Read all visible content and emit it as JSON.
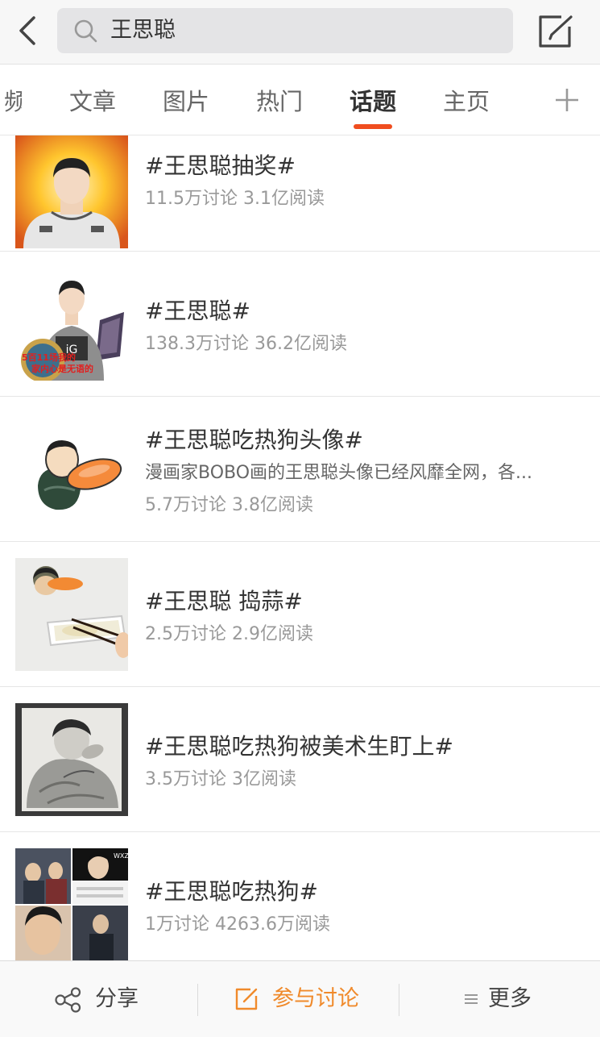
{
  "header": {
    "search_query": "王思聪"
  },
  "tabs": [
    {
      "label": "频"
    },
    {
      "label": "文章"
    },
    {
      "label": "图片"
    },
    {
      "label": "热门"
    },
    {
      "label": "话题"
    },
    {
      "label": "主页"
    }
  ],
  "active_tab": "话题",
  "topics": [
    {
      "title": "#王思聪抽奖#",
      "meta": "11.5万讨论 3.1亿阅读"
    },
    {
      "title": "#王思聪#",
      "meta": "138.3万讨论 36.2亿阅读",
      "badge_text": "5百11场我的家内心是无语的"
    },
    {
      "title": "#王思聪吃热狗头像#",
      "desc": "漫画家BOBO画的王思聪头像已经风靡全网，各...",
      "meta": "5.7万讨论 3.8亿阅读"
    },
    {
      "title": "#王思聪 捣蒜#",
      "meta": "2.5万讨论 2.9亿阅读"
    },
    {
      "title": "#王思聪吃热狗被美术生盯上#",
      "meta": "3.5万讨论 3亿阅读"
    },
    {
      "title": "#王思聪吃热狗#",
      "meta": "1万讨论 4263.6万阅读",
      "collage_text": "WXZ"
    }
  ],
  "bottom_bar": {
    "share_label": "分享",
    "discuss_label": "参与讨论",
    "more_label": "更多"
  },
  "colors": {
    "accent": "#f04d1f",
    "discuss": "#f08a2b",
    "text": "#333333",
    "meta": "#999999"
  },
  "icons": [
    "back-arrow-icon",
    "search-icon",
    "compose-icon",
    "plus-icon",
    "share-icon",
    "edit-icon",
    "menu-icon"
  ]
}
